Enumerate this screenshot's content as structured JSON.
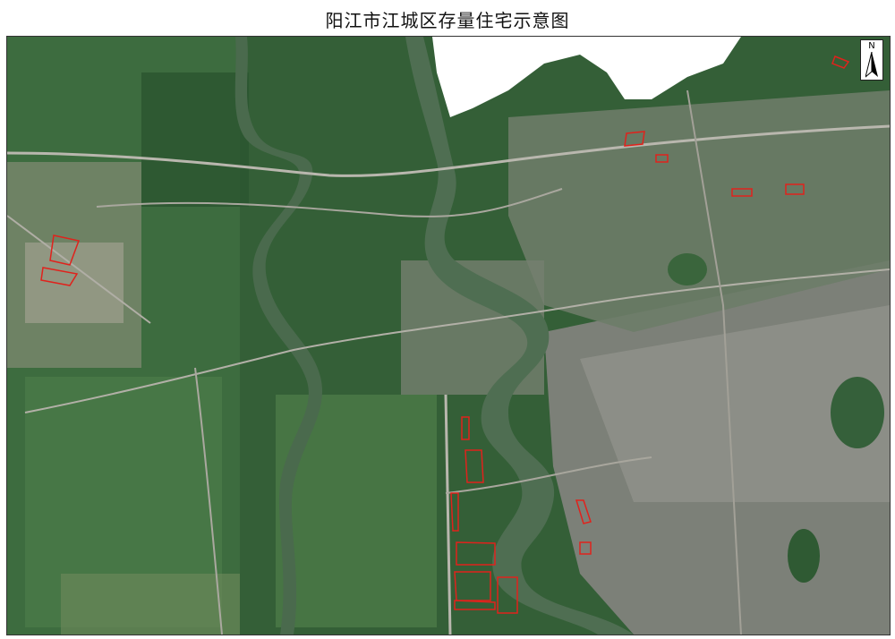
{
  "title": "阳江市江城区存量住宅示意图",
  "north_arrow": {
    "label": "N"
  },
  "colors": {
    "parcel_outline": "#e0221c",
    "river": "#4f6e52",
    "vegetation_dark": "#27502c",
    "vegetation_mid": "#3f7241",
    "farmland": "#6f9a5a",
    "urban": "#8d8f86",
    "sea": "#ffffff",
    "road": "#b9b7ae"
  },
  "parcels": [
    {
      "id": "parcel-1",
      "label": ""
    },
    {
      "id": "parcel-2",
      "label": ""
    },
    {
      "id": "parcel-3",
      "label": ""
    },
    {
      "id": "parcel-4",
      "label": ""
    },
    {
      "id": "parcel-5",
      "label": ""
    },
    {
      "id": "parcel-6",
      "label": ""
    },
    {
      "id": "parcel-7",
      "label": ""
    },
    {
      "id": "parcel-8",
      "label": ""
    },
    {
      "id": "parcel-9",
      "label": ""
    },
    {
      "id": "parcel-10",
      "label": ""
    },
    {
      "id": "parcel-11",
      "label": ""
    },
    {
      "id": "parcel-12",
      "label": ""
    },
    {
      "id": "parcel-13",
      "label": ""
    },
    {
      "id": "parcel-14",
      "label": ""
    },
    {
      "id": "parcel-15",
      "label": ""
    },
    {
      "id": "parcel-16",
      "label": ""
    }
  ]
}
